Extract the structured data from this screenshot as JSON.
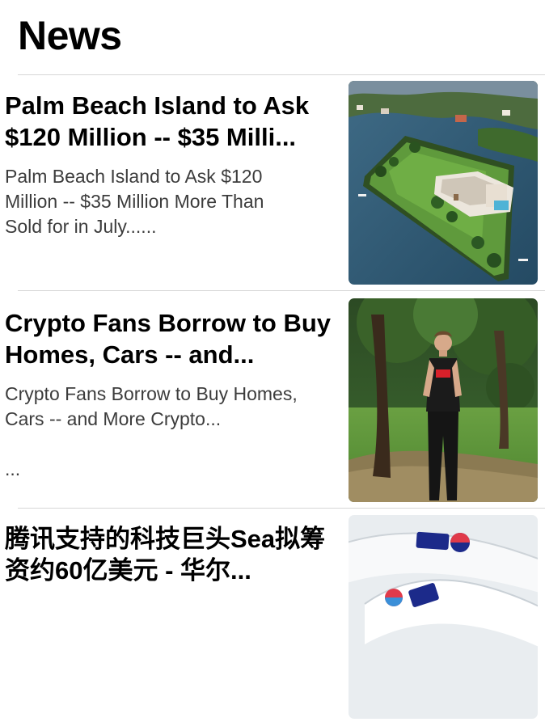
{
  "header": {
    "title": "News"
  },
  "articles": [
    {
      "headline": "Palm Beach Island to Ask $120 Million -- $35 Milli...",
      "summary": "Palm Beach Island to Ask $120\nMillion -- $35 Million More Than\nSold for in July......",
      "thumbnail": "aerial-island-mansion-image"
    },
    {
      "headline": "Crypto Fans Borrow to Buy Homes, Cars -- and...",
      "summary": "Crypto Fans Borrow to Buy Homes,\nCars -- and More Crypto...\n\n...",
      "thumbnail": "man-standing-in-park-image"
    },
    {
      "headline": "腾讯支持的科技巨头Sea拟筹资约60亿美元 - 华尔...",
      "summary": "",
      "thumbnail": "sea-logo-ribbon-image"
    }
  ]
}
